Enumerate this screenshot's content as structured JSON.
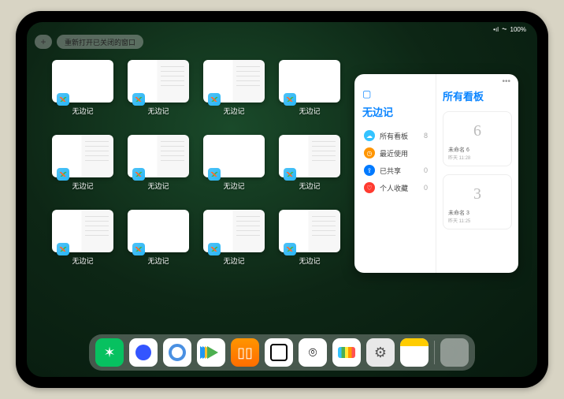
{
  "status": {
    "signal": "•ıl",
    "wifi": "⏦",
    "battery": "100%"
  },
  "topbar": {
    "plus": "+",
    "reopen_label": "重新打开已关闭的窗口"
  },
  "app_name": "无边记",
  "windows": [
    {
      "label": "无边记",
      "variant": "blank"
    },
    {
      "label": "无边记",
      "variant": "split"
    },
    {
      "label": "无边记",
      "variant": "split"
    },
    {
      "label": "无边记",
      "variant": "blank"
    },
    {
      "label": "无边记",
      "variant": "split"
    },
    {
      "label": "无边记",
      "variant": "split"
    },
    {
      "label": "无边记",
      "variant": "blank"
    },
    {
      "label": "无边记",
      "variant": "split"
    },
    {
      "label": "无边记",
      "variant": "split"
    },
    {
      "label": "无边记",
      "variant": "blank"
    },
    {
      "label": "无边记",
      "variant": "split"
    },
    {
      "label": "无边记",
      "variant": "split"
    }
  ],
  "panel": {
    "library_icon": "▢",
    "title": "无边记",
    "nav": [
      {
        "icon_class": "ic-blue-lt",
        "glyph": "☁",
        "label": "所有看板",
        "count": "8"
      },
      {
        "icon_class": "ic-orange",
        "glyph": "◷",
        "label": "最近使用",
        "count": ""
      },
      {
        "icon_class": "ic-blue",
        "glyph": "⇪",
        "label": "已共享",
        "count": "0"
      },
      {
        "icon_class": "ic-red",
        "glyph": "♡",
        "label": "个人收藏",
        "count": "0"
      }
    ],
    "right_title": "所有看板",
    "boards": [
      {
        "preview": "6",
        "name": "未命名 6",
        "time": "昨天 11:28"
      },
      {
        "preview": "3",
        "name": "未命名 3",
        "time": "昨天 11:25"
      }
    ]
  },
  "dock": [
    {
      "name": "wechat",
      "class": "ic-wechat",
      "glyph": "✶"
    },
    {
      "name": "quark",
      "class": "ic-quark",
      "glyph": ""
    },
    {
      "name": "qqbrowser",
      "class": "ic-qqb",
      "glyph": ""
    },
    {
      "name": "play",
      "class": "ic-play",
      "glyph": ""
    },
    {
      "name": "books",
      "class": "ic-books",
      "glyph": "▯▯"
    },
    {
      "name": "obsidian",
      "class": "ic-obs",
      "glyph": ""
    },
    {
      "name": "network",
      "class": "ic-net",
      "glyph": "⌾"
    },
    {
      "name": "freeform",
      "class": "ic-freeform",
      "glyph": ""
    },
    {
      "name": "settings",
      "class": "ic-settings",
      "glyph": "⚙"
    },
    {
      "name": "notes",
      "class": "ic-notes",
      "glyph": ""
    },
    {
      "name": "recent",
      "class": "ic-recent",
      "glyph": ""
    }
  ]
}
